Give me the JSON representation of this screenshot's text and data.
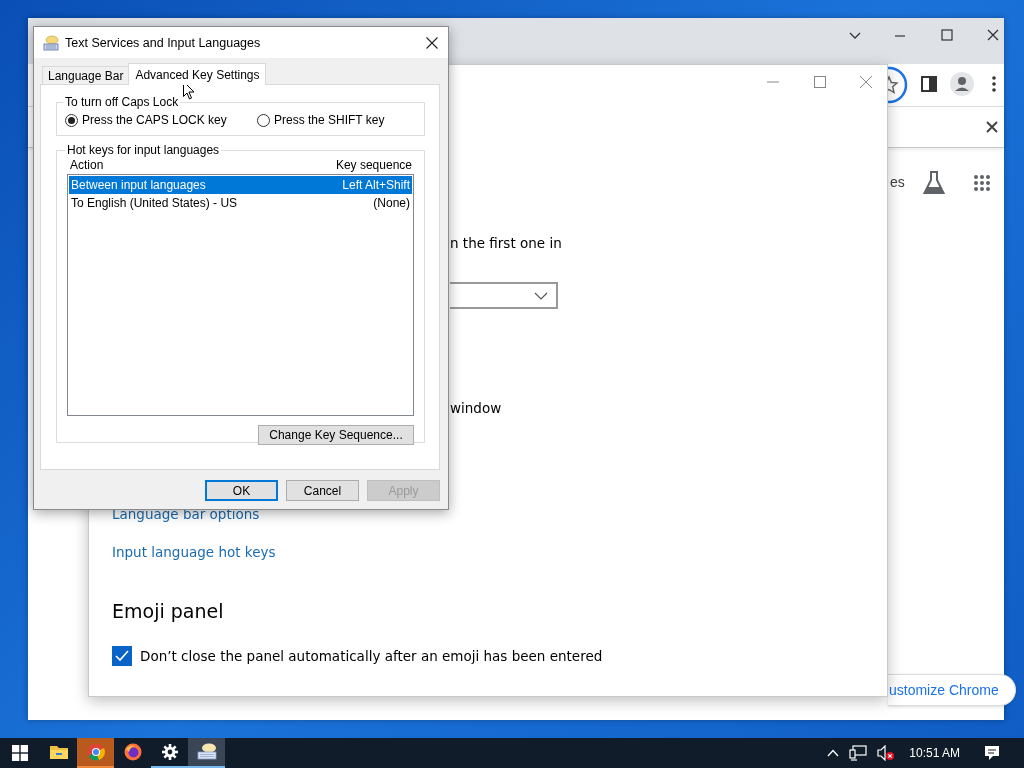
{
  "browser": {
    "page_text": "es",
    "customize_button": "ustomize Chrome"
  },
  "settings": {
    "partial_texts": [
      "n the first one in",
      "window"
    ],
    "links": [
      "Language bar options",
      "Input language hot keys"
    ],
    "section_title": "Emoji panel",
    "option": {
      "label": "Don’t close the panel automatically after an emoji has been entered",
      "checked": true
    }
  },
  "dialog": {
    "title": "Text Services and Input Languages",
    "tabs": [
      {
        "label": "Language Bar",
        "selected": false
      },
      {
        "label": "Advanced Key Settings",
        "selected": true
      }
    ],
    "caps_lock": {
      "title": "To turn off Caps Lock",
      "options": [
        {
          "label": "Press the CAPS LOCK key",
          "selected": true
        },
        {
          "label": "Press the SHIFT key",
          "selected": false
        }
      ]
    },
    "hot_keys": {
      "title": "Hot keys for input languages",
      "columns": [
        "Action",
        "Key sequence"
      ],
      "rows": [
        {
          "action": "Between input languages",
          "key_sequence": "Left Alt+Shift",
          "selected": true
        },
        {
          "action": "To English (United States) - US",
          "key_sequence": "(None)",
          "selected": false
        }
      ],
      "change_button": "Change Key Sequence..."
    },
    "buttons": [
      {
        "label": "OK",
        "default": true,
        "disabled": false
      },
      {
        "label": "Cancel",
        "default": false,
        "disabled": false
      },
      {
        "label": "Apply",
        "default": false,
        "disabled": true
      }
    ]
  },
  "taskbar": {
    "apps": [
      {
        "kind": "explorer",
        "running": false,
        "active": false,
        "attention": false
      },
      {
        "kind": "chrome",
        "running": false,
        "active": false,
        "attention": true
      },
      {
        "kind": "firefox",
        "running": false,
        "active": false,
        "attention": false
      },
      {
        "kind": "settings",
        "running": true,
        "active": false,
        "attention": false
      },
      {
        "kind": "keyboard",
        "running": true,
        "active": true,
        "attention": false
      }
    ],
    "clock": "10:51 AM"
  }
}
